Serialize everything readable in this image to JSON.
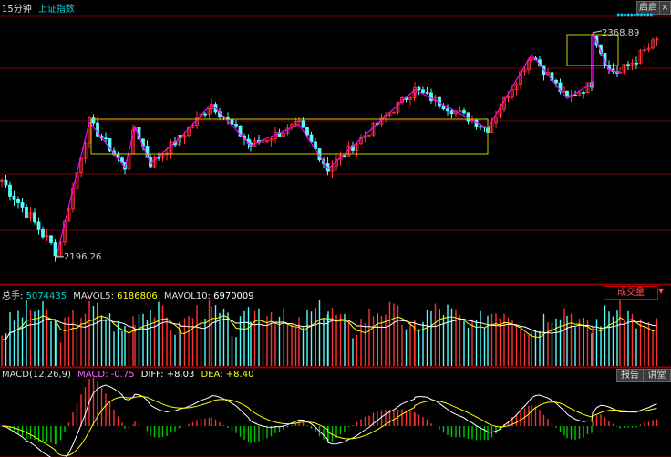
{
  "header": {
    "period": "15分钟",
    "index_name": "上证指数",
    "restore_button": "启启",
    "period_selector": "◆◆◆◆◆◆◆◆◆◆◆"
  },
  "price_panel": {
    "high_label": "2368.89",
    "low_label": "2196.26",
    "high_value": 2368.89,
    "low_value": 2196.26
  },
  "volume_panel": {
    "total_label": "总手:",
    "total_value": "5074435",
    "mavol5_label": "MAVOL5:",
    "mavol5_value": "6186806",
    "mavol10_label": "MAVOL10:",
    "mavol10_value": "6970009",
    "indicator_selector": "成交量",
    "selector_arrow": "▼"
  },
  "macd_panel": {
    "name": "MACD(12,26,9)",
    "macd_label": "MACD:",
    "macd_value": "-0.75",
    "diff_label": "DIFF:",
    "diff_value": "+8.03",
    "dea_label": "DEA:",
    "dea_value": "+8.40",
    "report_button": "报告",
    "lecture_button": "讲堂"
  },
  "colors": {
    "up": "#ff3232",
    "down": "#54fcfc",
    "ma_white": "#ffffff",
    "ma_yellow": "#ffff00",
    "zigzag": "#ff00ff",
    "box": "#cccc00",
    "grid": "#7a0000",
    "macd_up": "#ff3232",
    "macd_down": "#00c800",
    "label_cyan": "#00d0d0",
    "label_yellow": "#ffff00",
    "label_magenta": "#ff66ff"
  },
  "chart_data": {
    "type": "candlestick",
    "zigzag_pivots": [
      2196.26,
      2300,
      2265,
      2296,
      2268,
      2288,
      2314,
      2282,
      2298,
      2264,
      2325,
      2295,
      2352,
      2318,
      2330,
      2340,
      2368.89,
      2338
    ]
  }
}
